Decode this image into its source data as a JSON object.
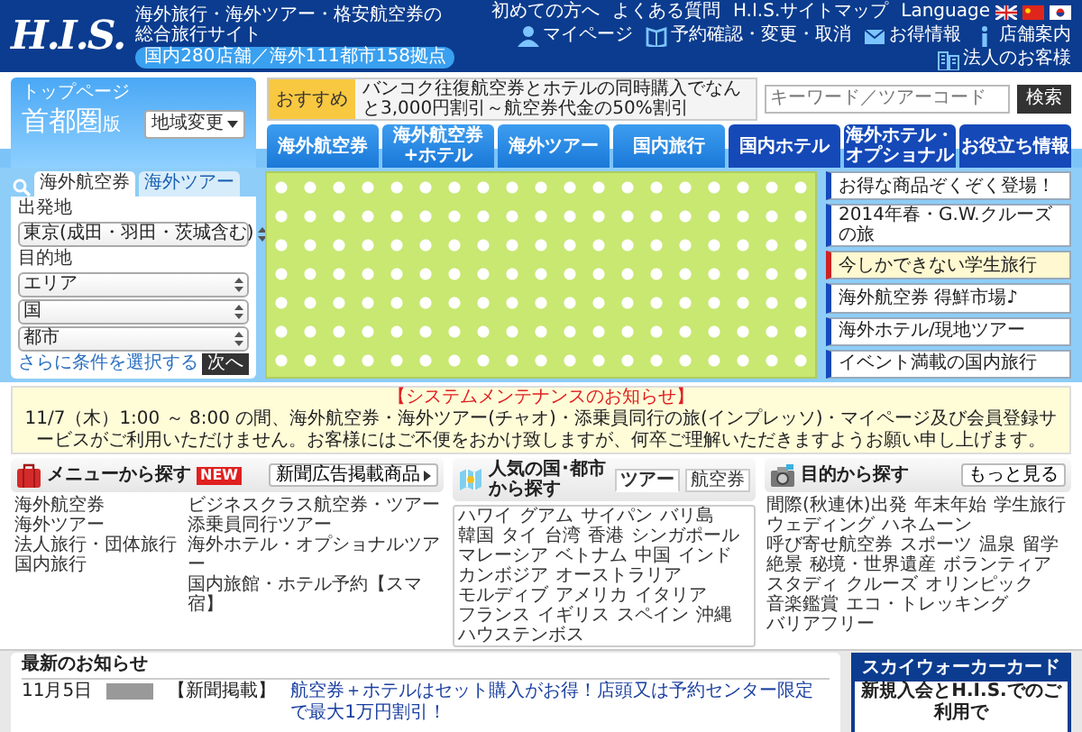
{
  "header": {
    "logo": "H.I.S.",
    "tagline": "海外旅行・海外ツアー・格安航空券の総合旅行サイト",
    "stores": "国内280店舗／海外111都市158拠点",
    "top_links": [
      "初めての方へ",
      "よくある質問",
      "H.I.S.サイトマップ"
    ],
    "language": "Language",
    "icon_links": [
      {
        "kind": "person",
        "label": "マイページ"
      },
      {
        "kind": "book",
        "label": "予約確認・変更・取消"
      },
      {
        "kind": "mail",
        "label": "お得情報"
      },
      {
        "kind": "info",
        "label": "店舗案内"
      },
      {
        "kind": "building",
        "label": "法人のお客様"
      }
    ]
  },
  "region": {
    "caption": "トップページ",
    "name": "首都圏",
    "suffix": "版",
    "button": "地域変更"
  },
  "recommend": {
    "label": "おすすめ",
    "text": "バンコク往復航空券とホテルの同時購入でなんと3,000円割引～航空券代金の50%割引"
  },
  "search": {
    "placeholder": "キーワード／ツアーコード",
    "button": "検索"
  },
  "nav_tabs": [
    {
      "label": "海外航空券",
      "kind": "light"
    },
    {
      "label": "海外航空券+ホテル",
      "kind": "light"
    },
    {
      "label": "海外ツアー",
      "kind": "light"
    },
    {
      "label": "国内旅行",
      "kind": "light"
    },
    {
      "label": "国内ホテル",
      "kind": "dark"
    },
    {
      "label": "海外ホテル・オプショナル",
      "kind": "dark"
    },
    {
      "label": "お役立ち情報",
      "kind": "dark"
    }
  ],
  "search_panel": {
    "tabs": [
      {
        "label": "海外航空券",
        "selected": true
      },
      {
        "label": "海外ツアー",
        "selected": false
      }
    ],
    "fields": [
      {
        "label": "出発地",
        "selects": [
          "東京(成田・羽田・茨城含む)"
        ]
      },
      {
        "label": "目的地",
        "selects": [
          "エリア",
          "国",
          "都市"
        ]
      }
    ],
    "more_link": "さらに条件を選択する",
    "next_button": "次へ"
  },
  "sidebar": {
    "items": [
      {
        "label": "お得な商品ぞくぞく登場！",
        "selected": false
      },
      {
        "label": "2014年春・G.W.クルーズの旅",
        "selected": false
      },
      {
        "label": "今しかできない学生旅行",
        "selected": true
      },
      {
        "label": "海外航空券 得鮮市場♪",
        "selected": false
      },
      {
        "label": "海外ホテル/現地ツアー",
        "selected": false
      },
      {
        "label": "イベント満載の国内旅行",
        "selected": false
      }
    ]
  },
  "notice": {
    "title": "【システムメンテナンスのお知らせ】",
    "body": "11/7（木）1:00 ～ 8:00 の間、海外航空券・海外ツアー(チャオ)・添乗員同行の旅(インプレッソ)・マイページ及び会員登録サービスがご利用いただけません。お客様にはご不便をおかけ致しますが、何卒ご理解いただきますようお願い申し上げます。"
  },
  "menu_section": {
    "title": "メニューから探す",
    "badge": "NEW",
    "button": "新聞広告掲載商品",
    "columns": [
      [
        "海外航空券",
        "海外ツアー",
        "法人旅行・団体旅行",
        "国内旅行"
      ],
      [
        "ビジネスクラス航空券・ツアー",
        "添乗員同行ツアー",
        "海外ホテル・オプショナルツアー",
        "国内旅館・ホテル予約【スマ宿】"
      ]
    ]
  },
  "popular_section": {
    "title": "人気の国･都市から探す",
    "tabs": [
      {
        "label": "ツアー",
        "selected": true
      },
      {
        "label": "航空券",
        "selected": false
      }
    ],
    "items": [
      "ハワイ",
      "グアム",
      "サイパン",
      "バリ島",
      "韓国",
      "タイ",
      "台湾",
      "香港",
      "シンガポール",
      "マレーシア",
      "ベトナム",
      "中国",
      "インド",
      "カンボジア",
      "オーストラリア",
      "モルディブ",
      "アメリカ",
      "イタリア",
      "フランス",
      "イギリス",
      "スペイン",
      "沖縄",
      "ハウステンボス"
    ]
  },
  "purpose_section": {
    "title": "目的から探す",
    "button": "もっと見る",
    "items": [
      "間際(秋連休)出発",
      "年末年始",
      "学生旅行",
      "ウェディング",
      "ハネムーン",
      "呼び寄せ航空券",
      "スポーツ",
      "温泉",
      "留学",
      "絶景",
      "秘境・世界遺産",
      "ボランティア",
      "スタディ",
      "クルーズ",
      "オリンピック",
      "音楽鑑賞",
      "エコ・トレッキング",
      "バリアフリー"
    ]
  },
  "news": {
    "title": "最新のお知らせ",
    "rows": [
      {
        "date": "11月5日",
        "category": "【新聞掲載】",
        "text": "航空券＋ホテルはセット購入がお得！店頭又は予約センター限定で最大1万円割引！"
      }
    ]
  },
  "card_ad": {
    "title": "スカイウォーカーカード",
    "text": "新規入会とH.I.S.でのご利用で"
  }
}
